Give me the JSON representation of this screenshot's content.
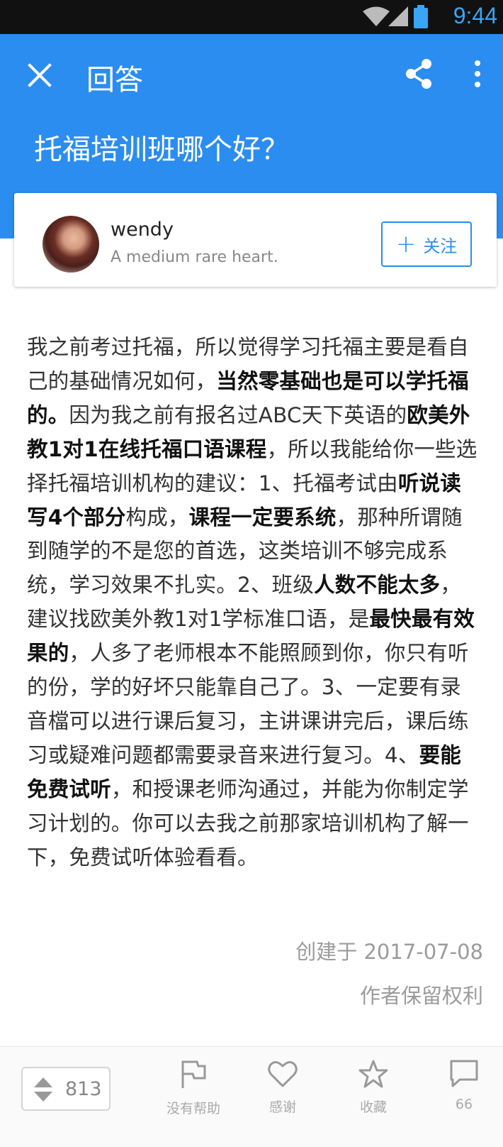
{
  "status": {
    "time": "9:44",
    "icons": [
      "wifi-icon",
      "signal-icon",
      "battery-icon"
    ]
  },
  "appbar": {
    "title": "回答",
    "question": "托福培训班哪个好？",
    "icons": [
      "close-icon",
      "share-icon",
      "more-vert-icon"
    ],
    "color": "#2b8df0"
  },
  "author": {
    "name": "wendy",
    "bio": "A medium rare heart.",
    "follow_label": "关注"
  },
  "answer": {
    "segments": [
      {
        "text": "我之前考过托福，所以觉得学习托福主要是看自己的基础情况如何，",
        "bold": false
      },
      {
        "text": "当然零基础也是可以学托福的。",
        "bold": true
      },
      {
        "text": "因为我之前有报名过ABC天下英语的",
        "bold": false
      },
      {
        "text": "欧美外教1对1在线托福口语课程",
        "bold": true
      },
      {
        "text": "，所以我能给你一些选择托福培训机构的建议：1、托福考试由",
        "bold": false
      },
      {
        "text": "听说读写4个部分",
        "bold": true
      },
      {
        "text": "构成，",
        "bold": false
      },
      {
        "text": "课程一定要系统",
        "bold": true
      },
      {
        "text": "，那种所谓随到随学的不是您的首选，这类培训不够完成系统，学习效果不扎实。2、班级",
        "bold": false
      },
      {
        "text": "人数不能太多",
        "bold": true
      },
      {
        "text": "，建议找欧美外教1对1学标准口语，是",
        "bold": false
      },
      {
        "text": "最快最有效果的",
        "bold": true
      },
      {
        "text": "，人多了老师根本不能照顾到你，你只有听的份，学的好坏只能靠自己了。3、一定要有录音檔可以进行课后复习，主讲课讲完后，课后练习或疑难问题都需要录音来进行复习。4、",
        "bold": false
      },
      {
        "text": "要能免费试听",
        "bold": true
      },
      {
        "text": "，和授课老师沟通过，并能为你制定学习计划的。你可以去我之前那家培训机构了解一下，免费试听体验看看。",
        "bold": false
      }
    ],
    "created": "创建于 2017-07-08",
    "rights": "作者保留权利"
  },
  "bottom": {
    "vote_count": "813",
    "actions": [
      {
        "label": "没有帮助",
        "icon": "flag-icon"
      },
      {
        "label": "感谢",
        "icon": "heart-icon"
      },
      {
        "label": "收藏",
        "icon": "star-icon"
      },
      {
        "label": "66",
        "icon": "comment-icon"
      }
    ]
  }
}
